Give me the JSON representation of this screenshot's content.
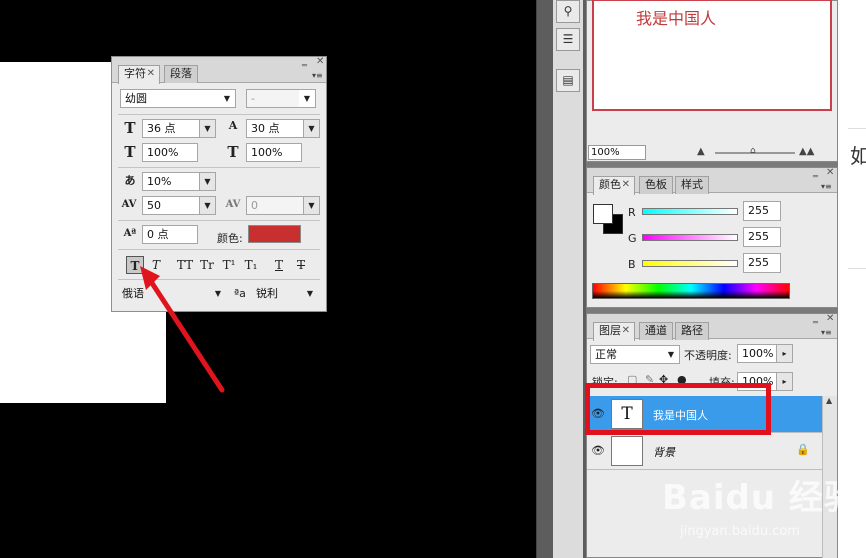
{
  "character_panel": {
    "tabs": [
      {
        "label": "字符",
        "close": "✕"
      },
      {
        "label": "段落"
      }
    ],
    "window_controls": [
      "‗",
      "✕"
    ],
    "menu": "▾≡",
    "font_family": "幼圆",
    "font_style": "-",
    "font_size": "36 点",
    "leading": "30 点",
    "vertical_scale": "100%",
    "horizontal_scale": "100%",
    "tracking_ratio": "10%",
    "tracking": "50",
    "kerning": "0",
    "baseline_shift": "0 点",
    "color_label": "颜色:",
    "text_color": "#c8302f",
    "style_buttons": [
      "T",
      "T",
      "TT",
      "Tr",
      "T¹",
      "T₁",
      "T",
      "T"
    ],
    "language": "俄语",
    "aa_label": "ªa",
    "anti_alias": "锐利"
  },
  "navigator": {
    "preview_text": "我是中国人",
    "zoom": "100%"
  },
  "color_panel": {
    "tabs": [
      {
        "label": "颜色",
        "close": "✕"
      },
      {
        "label": "色板"
      },
      {
        "label": "样式"
      }
    ],
    "channels": [
      {
        "label": "R",
        "value": "255"
      },
      {
        "label": "G",
        "value": "255"
      },
      {
        "label": "B",
        "value": "255"
      }
    ]
  },
  "layers_panel": {
    "tabs": [
      {
        "label": "图层",
        "close": "✕"
      },
      {
        "label": "通道"
      },
      {
        "label": "路径"
      }
    ],
    "blend_mode": "正常",
    "opacity_label": "不透明度:",
    "opacity": "100%",
    "lock_label": "锁定:",
    "fill_label": "填充:",
    "fill": "100%",
    "layers": [
      {
        "name": "我是中国人",
        "thumb": "T",
        "selected": true
      },
      {
        "name": "背景",
        "thumb": "",
        "selected": false
      }
    ]
  },
  "far_right_text": "如",
  "watermark": {
    "main": "Baidu 经验",
    "sub": "jingyan.baidu.com"
  },
  "colors": {
    "highlight": "#e2101c",
    "selection": "#3a9bea",
    "swatch": "#c8302f"
  }
}
